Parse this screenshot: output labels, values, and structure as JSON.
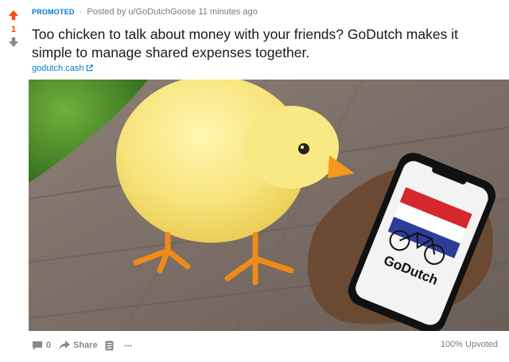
{
  "post": {
    "score": "1",
    "promoted_label": "PROMOTED",
    "separator": "·",
    "posted_by": "Posted by u/GoDutchGoose",
    "time": "11 minutes ago",
    "title": "Too chicken to talk about money with your friends? GoDutch makes it simple to manage shared expenses together.",
    "link_text": "godutch.cash",
    "phone_logo_text": "GoDutch"
  },
  "footer": {
    "comments_count": "0",
    "share_label": "Share",
    "more_label": "···",
    "upvoted": "100% Upvoted"
  },
  "colors": {
    "upvote": "#ff4500",
    "link": "#0079d3",
    "muted": "#878a8c"
  },
  "icons": [
    "upvote-arrow-icon",
    "downvote-arrow-icon",
    "external-link-icon",
    "comment-icon",
    "share-icon",
    "save-icon",
    "more-icon"
  ]
}
